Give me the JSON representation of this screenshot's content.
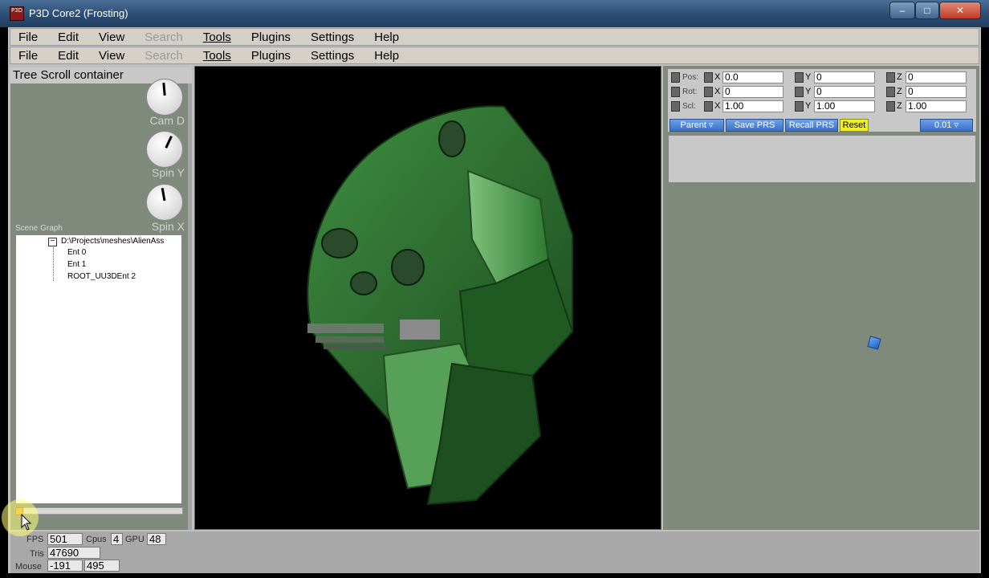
{
  "window": {
    "title": "P3D Core2 (Frosting)",
    "icon_text": "P3D",
    "min_glyph": "–",
    "max_glyph": "□",
    "close_glyph": "✕"
  },
  "menu": {
    "items": [
      "File",
      "Edit",
      "View",
      "Search",
      "Tools",
      "Plugins",
      "Settings",
      "Help"
    ]
  },
  "left_panel": {
    "header": "Tree Scroll container",
    "knobs": [
      {
        "label": "Cam D",
        "angle": -5
      },
      {
        "label": "Spin Y",
        "angle": 25
      },
      {
        "label": "Spin X",
        "angle": -10
      }
    ],
    "scene_graph_label": "Scene Graph",
    "tree": {
      "toggle": "−",
      "root": "D:\\Projects\\meshes\\AlienAss",
      "children": [
        "Ent 0",
        "Ent 1",
        "ROOT_UU3DEnt 2"
      ]
    }
  },
  "prs": {
    "rows": [
      {
        "label": "Pos:",
        "x": "0.0",
        "y": "0",
        "z": "0"
      },
      {
        "label": "Rot:",
        "x": "0",
        "y": "0",
        "z": "0"
      },
      {
        "label": "Scl:",
        "x": "1.00",
        "y": "1.00",
        "z": "1.00"
      }
    ],
    "axis_x": "X",
    "axis_y": "Y",
    "axis_z": "Z",
    "buttons": {
      "parent": "Parent ▿",
      "save": "Save PRS",
      "recall": "Recall PRS",
      "reset": "Reset",
      "step": "0.01 ▿"
    }
  },
  "status": {
    "fps_label": "FPS",
    "fps": "501",
    "cpus_label": "Cpus",
    "cpus": "4",
    "gpu_label": "GPU",
    "gpu": "48",
    "tris_label": "Tris",
    "tris": "47690",
    "mouse_label": "Mouse",
    "mouse_x": "-191",
    "mouse_y": "495"
  },
  "colors": {
    "panel_bg": "#7f8a7c",
    "ship_green": "#2f7a32",
    "reset_btn": "#f0f020",
    "accent_blue": "#3a6fc8"
  }
}
